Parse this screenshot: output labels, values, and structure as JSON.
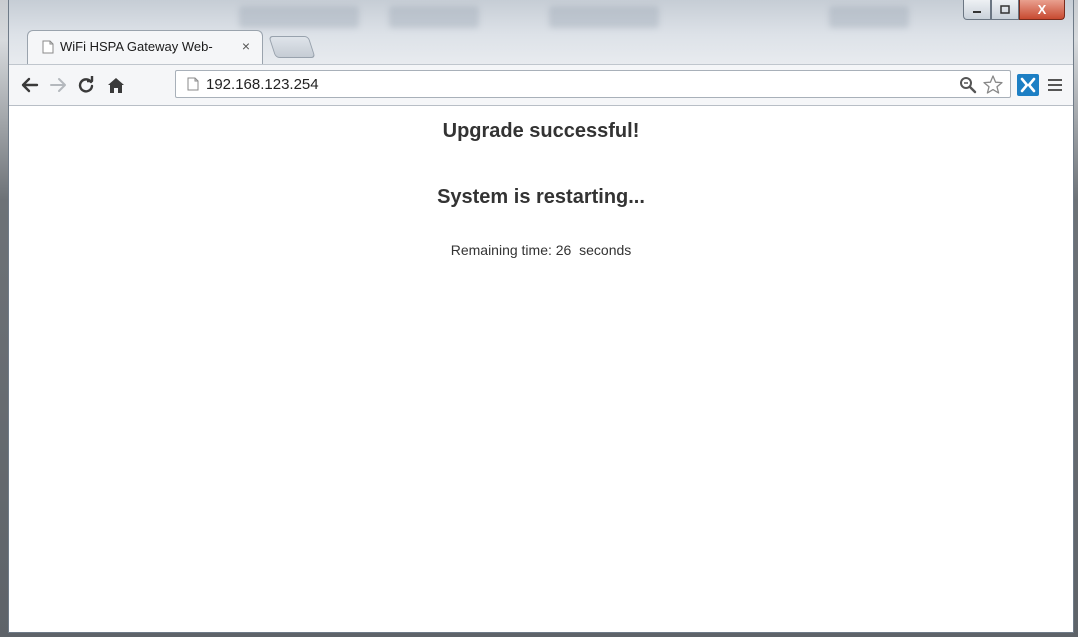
{
  "browser": {
    "tab_title": "WiFi HSPA Gateway Web-",
    "tab_close": "×",
    "url": "192.168.123.254",
    "window_controls": {
      "minimize": "▁",
      "maximize": "□",
      "close": "X"
    },
    "extension_label": "✕"
  },
  "page": {
    "heading_success": "Upgrade successful!",
    "heading_restart": "System is restarting...",
    "remaining_label": "Remaining time: ",
    "remaining_value": "26",
    "remaining_unit": "  seconds"
  },
  "icons": {
    "back": "back-arrow-icon",
    "forward": "forward-arrow-icon",
    "reload": "reload-icon",
    "home": "home-icon",
    "page": "page-icon",
    "zoom": "magnifier-icon",
    "bookmark": "star-icon",
    "extension": "extension-icon",
    "menu": "hamburger-menu-icon"
  }
}
